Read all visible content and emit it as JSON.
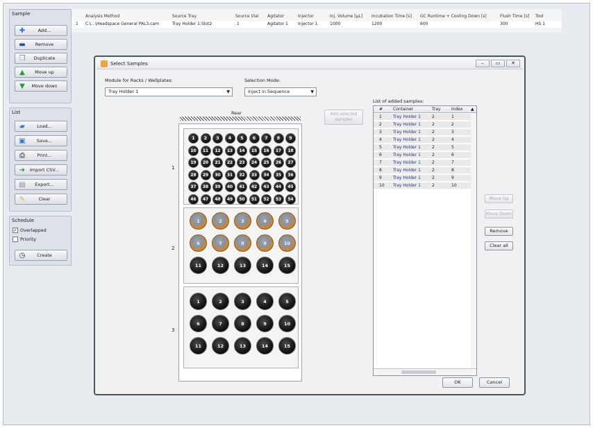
{
  "left_panel": {
    "sample_title": "Sample",
    "sample_buttons": [
      {
        "label": "Add...",
        "icon": "plus-icon"
      },
      {
        "label": "Remove",
        "icon": "remove-icon"
      },
      {
        "label": "Duplicate",
        "icon": "duplicate-icon"
      },
      {
        "label": "Move up",
        "icon": "arrow-up-icon"
      },
      {
        "label": "Move down",
        "icon": "arrow-down-icon"
      }
    ],
    "list_title": "List",
    "list_buttons": [
      {
        "label": "Load...",
        "icon": "folder-icon"
      },
      {
        "label": "Save...",
        "icon": "save-icon"
      },
      {
        "label": "Print...",
        "icon": "printer-icon"
      },
      {
        "label": "Import CSV...",
        "icon": "import-icon"
      },
      {
        "label": "Export...",
        "icon": "export-icon"
      },
      {
        "label": "Clear",
        "icon": "eraser-icon"
      }
    ],
    "schedule_title": "Schedule",
    "overlapped_label": "Overlapped",
    "overlapped_checked": "✓",
    "priority_label": "Priority",
    "create_label": "Create"
  },
  "top_table": {
    "headers": [
      "Analysis Method",
      "Source Tray",
      "Source Vial",
      "Agitator",
      "Injector",
      "Inj. Volume [µL]",
      "Incubation Time [s]",
      "GC Runtime + Cooling Down [s]",
      "Flush Time [s]",
      "Tool"
    ],
    "row": [
      "1",
      "C:\\...\\Headspace General PAL3.cam",
      "Tray Holder 1:Slot2",
      "1",
      "Agitator 1",
      "Injector 1",
      "1000",
      "1200",
      "600",
      "300",
      "HS 1"
    ]
  },
  "dialog": {
    "title": "Select Samples",
    "module_label": "Module for Racks / Wellplates:",
    "module_value": "Tray Holder 1",
    "selection_label": "Selection Mode:",
    "selection_value": "Inject in Sequence",
    "rear_label": "Rear",
    "add_selected_label": "Add selected samples",
    "list_title": "List of added samples:",
    "list_headers": [
      "#",
      "Container",
      "Tray",
      "Index"
    ],
    "list_rows": [
      [
        "1",
        "Tray Holder 1",
        "2",
        "1"
      ],
      [
        "2",
        "Tray Holder 1",
        "2",
        "2"
      ],
      [
        "3",
        "Tray Holder 1",
        "2",
        "3"
      ],
      [
        "4",
        "Tray Holder 1",
        "2",
        "4"
      ],
      [
        "5",
        "Tray Holder 1",
        "2",
        "5"
      ],
      [
        "6",
        "Tray Holder 1",
        "2",
        "6"
      ],
      [
        "7",
        "Tray Holder 1",
        "2",
        "7"
      ],
      [
        "8",
        "Tray Holder 1",
        "2",
        "8"
      ],
      [
        "9",
        "Tray Holder 1",
        "2",
        "9"
      ],
      [
        "10",
        "Tray Holder 1",
        "2",
        "10"
      ]
    ],
    "move_up_label": "Move Up",
    "move_down_label": "Move Down",
    "remove_label": "Remove",
    "clear_all_label": "Clear all",
    "ok_label": "OK",
    "cancel_label": "Cancel",
    "racks": [
      {
        "number": "1",
        "vial_count": 54,
        "selected": []
      },
      {
        "number": "2",
        "vial_count": 15,
        "selected": [
          1,
          2,
          3,
          4,
          5,
          6,
          7,
          8,
          9,
          10
        ]
      },
      {
        "number": "3",
        "vial_count": 15,
        "selected": []
      }
    ]
  },
  "colors": {
    "vial": "#111111",
    "selected_ring": "#c68a3a",
    "row_bg": "#ebe8e8",
    "container_text": "#1e3a8a"
  }
}
